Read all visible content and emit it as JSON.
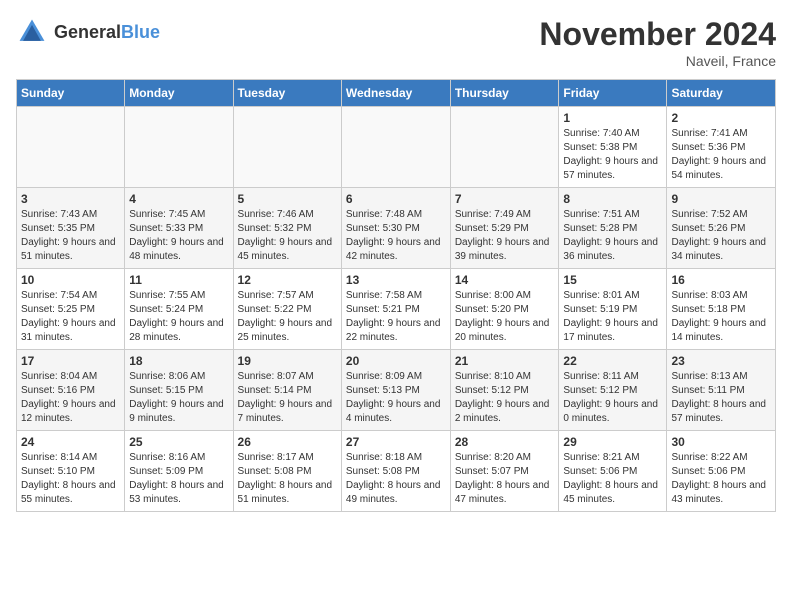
{
  "header": {
    "logo_general": "General",
    "logo_blue": "Blue",
    "month_title": "November 2024",
    "location": "Naveil, France"
  },
  "weekdays": [
    "Sunday",
    "Monday",
    "Tuesday",
    "Wednesday",
    "Thursday",
    "Friday",
    "Saturday"
  ],
  "rows": [
    {
      "cells": [
        {
          "day": "",
          "empty": true
        },
        {
          "day": "",
          "empty": true
        },
        {
          "day": "",
          "empty": true
        },
        {
          "day": "",
          "empty": true
        },
        {
          "day": "",
          "empty": true
        },
        {
          "day": "1",
          "sunrise": "Sunrise: 7:40 AM",
          "sunset": "Sunset: 5:38 PM",
          "daylight": "Daylight: 9 hours and 57 minutes."
        },
        {
          "day": "2",
          "sunrise": "Sunrise: 7:41 AM",
          "sunset": "Sunset: 5:36 PM",
          "daylight": "Daylight: 9 hours and 54 minutes."
        }
      ]
    },
    {
      "cells": [
        {
          "day": "3",
          "sunrise": "Sunrise: 7:43 AM",
          "sunset": "Sunset: 5:35 PM",
          "daylight": "Daylight: 9 hours and 51 minutes."
        },
        {
          "day": "4",
          "sunrise": "Sunrise: 7:45 AM",
          "sunset": "Sunset: 5:33 PM",
          "daylight": "Daylight: 9 hours and 48 minutes."
        },
        {
          "day": "5",
          "sunrise": "Sunrise: 7:46 AM",
          "sunset": "Sunset: 5:32 PM",
          "daylight": "Daylight: 9 hours and 45 minutes."
        },
        {
          "day": "6",
          "sunrise": "Sunrise: 7:48 AM",
          "sunset": "Sunset: 5:30 PM",
          "daylight": "Daylight: 9 hours and 42 minutes."
        },
        {
          "day": "7",
          "sunrise": "Sunrise: 7:49 AM",
          "sunset": "Sunset: 5:29 PM",
          "daylight": "Daylight: 9 hours and 39 minutes."
        },
        {
          "day": "8",
          "sunrise": "Sunrise: 7:51 AM",
          "sunset": "Sunset: 5:28 PM",
          "daylight": "Daylight: 9 hours and 36 minutes."
        },
        {
          "day": "9",
          "sunrise": "Sunrise: 7:52 AM",
          "sunset": "Sunset: 5:26 PM",
          "daylight": "Daylight: 9 hours and 34 minutes."
        }
      ]
    },
    {
      "cells": [
        {
          "day": "10",
          "sunrise": "Sunrise: 7:54 AM",
          "sunset": "Sunset: 5:25 PM",
          "daylight": "Daylight: 9 hours and 31 minutes."
        },
        {
          "day": "11",
          "sunrise": "Sunrise: 7:55 AM",
          "sunset": "Sunset: 5:24 PM",
          "daylight": "Daylight: 9 hours and 28 minutes."
        },
        {
          "day": "12",
          "sunrise": "Sunrise: 7:57 AM",
          "sunset": "Sunset: 5:22 PM",
          "daylight": "Daylight: 9 hours and 25 minutes."
        },
        {
          "day": "13",
          "sunrise": "Sunrise: 7:58 AM",
          "sunset": "Sunset: 5:21 PM",
          "daylight": "Daylight: 9 hours and 22 minutes."
        },
        {
          "day": "14",
          "sunrise": "Sunrise: 8:00 AM",
          "sunset": "Sunset: 5:20 PM",
          "daylight": "Daylight: 9 hours and 20 minutes."
        },
        {
          "day": "15",
          "sunrise": "Sunrise: 8:01 AM",
          "sunset": "Sunset: 5:19 PM",
          "daylight": "Daylight: 9 hours and 17 minutes."
        },
        {
          "day": "16",
          "sunrise": "Sunrise: 8:03 AM",
          "sunset": "Sunset: 5:18 PM",
          "daylight": "Daylight: 9 hours and 14 minutes."
        }
      ]
    },
    {
      "cells": [
        {
          "day": "17",
          "sunrise": "Sunrise: 8:04 AM",
          "sunset": "Sunset: 5:16 PM",
          "daylight": "Daylight: 9 hours and 12 minutes."
        },
        {
          "day": "18",
          "sunrise": "Sunrise: 8:06 AM",
          "sunset": "Sunset: 5:15 PM",
          "daylight": "Daylight: 9 hours and 9 minutes."
        },
        {
          "day": "19",
          "sunrise": "Sunrise: 8:07 AM",
          "sunset": "Sunset: 5:14 PM",
          "daylight": "Daylight: 9 hours and 7 minutes."
        },
        {
          "day": "20",
          "sunrise": "Sunrise: 8:09 AM",
          "sunset": "Sunset: 5:13 PM",
          "daylight": "Daylight: 9 hours and 4 minutes."
        },
        {
          "day": "21",
          "sunrise": "Sunrise: 8:10 AM",
          "sunset": "Sunset: 5:12 PM",
          "daylight": "Daylight: 9 hours and 2 minutes."
        },
        {
          "day": "22",
          "sunrise": "Sunrise: 8:11 AM",
          "sunset": "Sunset: 5:12 PM",
          "daylight": "Daylight: 9 hours and 0 minutes."
        },
        {
          "day": "23",
          "sunrise": "Sunrise: 8:13 AM",
          "sunset": "Sunset: 5:11 PM",
          "daylight": "Daylight: 8 hours and 57 minutes."
        }
      ]
    },
    {
      "cells": [
        {
          "day": "24",
          "sunrise": "Sunrise: 8:14 AM",
          "sunset": "Sunset: 5:10 PM",
          "daylight": "Daylight: 8 hours and 55 minutes."
        },
        {
          "day": "25",
          "sunrise": "Sunrise: 8:16 AM",
          "sunset": "Sunset: 5:09 PM",
          "daylight": "Daylight: 8 hours and 53 minutes."
        },
        {
          "day": "26",
          "sunrise": "Sunrise: 8:17 AM",
          "sunset": "Sunset: 5:08 PM",
          "daylight": "Daylight: 8 hours and 51 minutes."
        },
        {
          "day": "27",
          "sunrise": "Sunrise: 8:18 AM",
          "sunset": "Sunset: 5:08 PM",
          "daylight": "Daylight: 8 hours and 49 minutes."
        },
        {
          "day": "28",
          "sunrise": "Sunrise: 8:20 AM",
          "sunset": "Sunset: 5:07 PM",
          "daylight": "Daylight: 8 hours and 47 minutes."
        },
        {
          "day": "29",
          "sunrise": "Sunrise: 8:21 AM",
          "sunset": "Sunset: 5:06 PM",
          "daylight": "Daylight: 8 hours and 45 minutes."
        },
        {
          "day": "30",
          "sunrise": "Sunrise: 8:22 AM",
          "sunset": "Sunset: 5:06 PM",
          "daylight": "Daylight: 8 hours and 43 minutes."
        }
      ]
    }
  ]
}
